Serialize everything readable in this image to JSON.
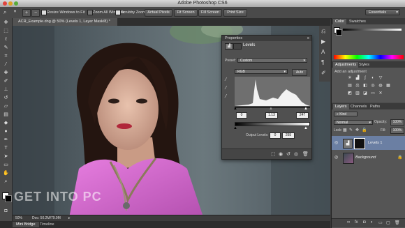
{
  "window": {
    "title": "Adobe Photoshop CS6"
  },
  "options_bar": {
    "resize_windows_label": "Resize Windows to Fit",
    "zoom_all_label": "Zoom All Windows",
    "scrubby_zoom_label": "Scrubby Zoom",
    "actual_pixels_label": "Actual Pixels",
    "fit_screen_label": "Fit Screen",
    "fill_screen_label": "Fill Screen",
    "print_size_label": "Print Size",
    "workspace_label": "Essentials"
  },
  "document": {
    "tab_label": "ACR_Example.dng @ 50% (Levels 1, Layer Mask/8) *",
    "status": "Doc: 50.2M/79.9M",
    "zoom": "50%"
  },
  "watermark": "GET INTO PC",
  "bottom_tabs": [
    "Mini Bridge",
    "Timeline"
  ],
  "properties": {
    "header": "Properties",
    "title": "Levels",
    "preset_label": "Preset:",
    "preset_value": "Custom",
    "channel_value": "RGB",
    "auto_label": "Auto",
    "input_black": "0",
    "input_mid": "1.13",
    "input_white": "247",
    "output_label": "Output Levels:",
    "output_black": "0",
    "output_white": "255"
  },
  "color_panel": {
    "tabs": [
      "Color",
      "Swatches"
    ]
  },
  "adjustments_panel": {
    "tabs": [
      "Adjustments",
      "Styles"
    ],
    "add_label": "Add an adjustment"
  },
  "layers_panel": {
    "tabs": [
      "Layers",
      "Channels",
      "Paths"
    ],
    "kind_label": "Kind",
    "blend_mode": "Normal",
    "opacity_label": "Opacity:",
    "opacity_value": "100%",
    "lock_label": "Lock:",
    "fill_label": "Fill:",
    "fill_value": "100%",
    "layers": [
      {
        "name": "Levels 1"
      },
      {
        "name": "Background"
      }
    ]
  }
}
